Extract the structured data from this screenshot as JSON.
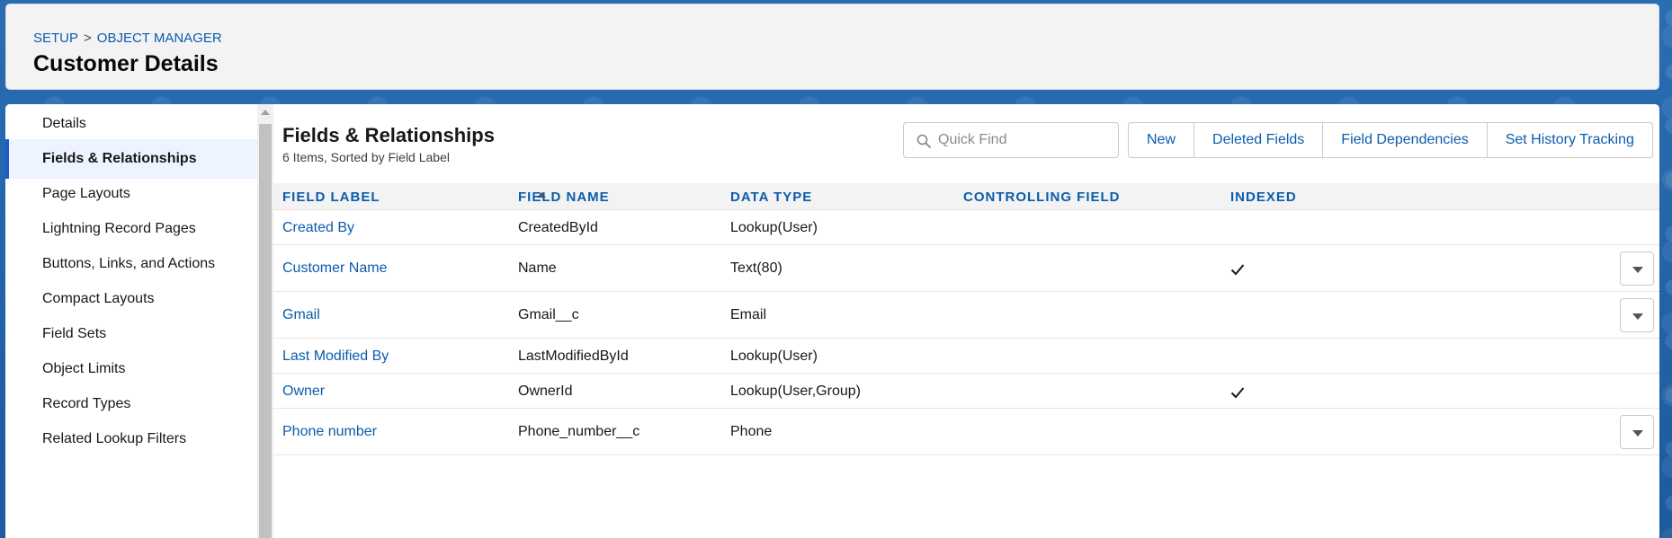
{
  "breadcrumb": {
    "setup": "SETUP",
    "separator": ">",
    "object_manager": "OBJECT MANAGER"
  },
  "page": {
    "title": "Customer Details"
  },
  "sidebar": {
    "items": [
      {
        "label": "Details",
        "active": false
      },
      {
        "label": "Fields & Relationships",
        "active": true
      },
      {
        "label": "Page Layouts",
        "active": false
      },
      {
        "label": "Lightning Record Pages",
        "active": false
      },
      {
        "label": "Buttons, Links, and Actions",
        "active": false
      },
      {
        "label": "Compact Layouts",
        "active": false
      },
      {
        "label": "Field Sets",
        "active": false
      },
      {
        "label": "Object Limits",
        "active": false
      },
      {
        "label": "Record Types",
        "active": false
      },
      {
        "label": "Related Lookup Filters",
        "active": false
      }
    ]
  },
  "section": {
    "title": "Fields & Relationships",
    "subtitle": "6 Items, Sorted by Field Label"
  },
  "search": {
    "placeholder": "Quick Find",
    "value": ""
  },
  "toolbar": {
    "new_label": "New",
    "deleted_fields_label": "Deleted Fields",
    "field_dependencies_label": "Field Dependencies",
    "history_tracking_label": "Set History Tracking"
  },
  "table": {
    "columns": [
      "FIELD LABEL",
      "FIELD NAME",
      "DATA TYPE",
      "CONTROLLING FIELD",
      "INDEXED"
    ],
    "rows": [
      {
        "label": "Created By",
        "name": "CreatedById",
        "type": "Lookup(User)",
        "controlling": "",
        "indexed": false,
        "menu": false
      },
      {
        "label": "Customer Name",
        "name": "Name",
        "type": "Text(80)",
        "controlling": "",
        "indexed": true,
        "menu": true
      },
      {
        "label": "Gmail",
        "name": "Gmail__c",
        "type": "Email",
        "controlling": "",
        "indexed": false,
        "menu": true
      },
      {
        "label": "Last Modified By",
        "name": "LastModifiedById",
        "type": "Lookup(User)",
        "controlling": "",
        "indexed": false,
        "menu": false
      },
      {
        "label": "Owner",
        "name": "OwnerId",
        "type": "Lookup(User,Group)",
        "controlling": "",
        "indexed": true,
        "menu": false
      },
      {
        "label": "Phone number",
        "name": "Phone_number__c",
        "type": "Phone",
        "controlling": "",
        "indexed": false,
        "menu": true
      }
    ]
  },
  "colors": {
    "link": "#0b5cab",
    "active_bar": "#1b5bd1",
    "header_bg": "#f3f3f3"
  }
}
